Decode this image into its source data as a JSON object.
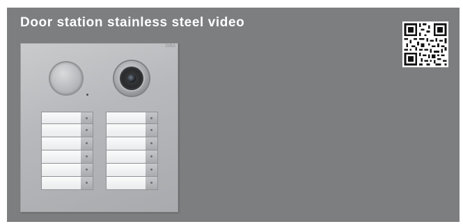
{
  "card": {
    "title": "Door station stainless steel video",
    "background_color": "#7d7e80",
    "title_color": "#ffffff"
  },
  "product": {
    "brand_mark": "GIRA",
    "components": [
      "speaker-grille",
      "microphone-dot",
      "video-camera"
    ],
    "left_column_buttons": 6,
    "right_column_buttons": 6
  },
  "qr_code": {
    "icon": "qr-code-icon"
  }
}
